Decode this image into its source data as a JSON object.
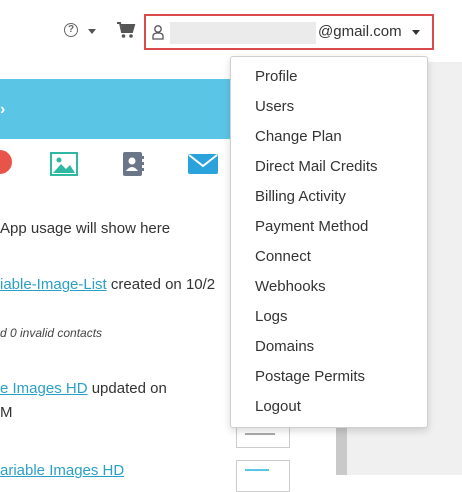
{
  "header": {
    "help_symbol": "?",
    "email_suffix": "@gmail.com"
  },
  "content": {
    "usage_text": "App usage will show here",
    "item1_link": "iable-Image-List",
    "item1_rest": " created on 10/2",
    "item1_sub": "d 0 invalid contacts",
    "item2_link": "e Images HD",
    "item2_rest": " updated on",
    "item2_line2": "M",
    "item3_link": "ariable Images HD"
  },
  "menu": {
    "items": [
      "Profile",
      "Users",
      "Change Plan",
      "Direct Mail Credits",
      "Billing Activity",
      "Payment Method",
      "Connect",
      "Webhooks",
      "Logs",
      "Domains",
      "Postage Permits",
      "Logout"
    ]
  },
  "colors": {
    "band": "#5bc5e6",
    "link": "#2aa0c9",
    "highlight_border": "#d94a4a",
    "icon_teal": "#2fb9a4",
    "icon_gray": "#6b7788",
    "icon_blue": "#2aa3dc",
    "icon_red": "#e8544a"
  }
}
